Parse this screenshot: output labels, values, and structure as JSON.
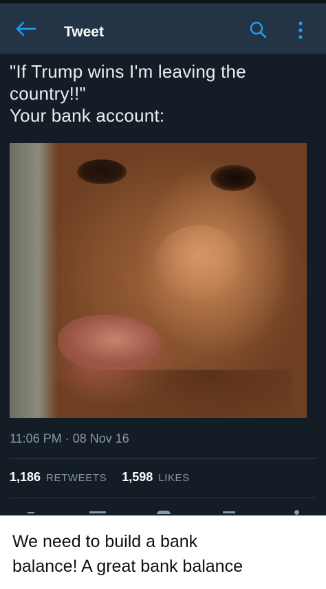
{
  "header": {
    "title": "Tweet"
  },
  "icons": {
    "back": "arrow-left-icon",
    "search": "search-icon",
    "more": "more-vertical-icon"
  },
  "tweet": {
    "text_lines": [
      "\"If Trump wins I'm leaving the",
      "country!!\"",
      "Your bank account:"
    ],
    "timestamp": "11:06 PM · 08 Nov 16",
    "retweets_count": "1,186",
    "retweets_label": "RETWEETS",
    "likes_count": "1,598",
    "likes_label": "LIKES"
  },
  "caption": {
    "lines": [
      "We need to build a bank",
      "balance! A great bank balance"
    ]
  },
  "colors": {
    "background": "#141d26",
    "header": "#243447",
    "accent": "#1da1f2",
    "muted": "#8899a6",
    "text": "#ffffff"
  }
}
